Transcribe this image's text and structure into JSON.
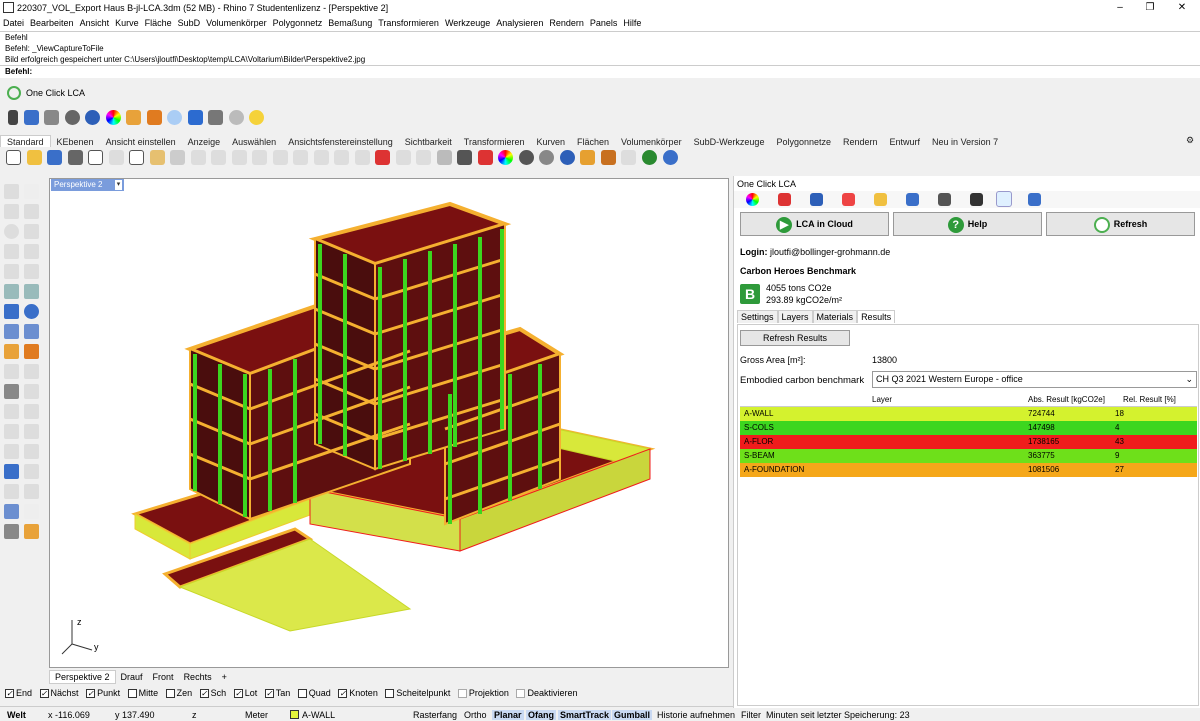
{
  "titlebar": {
    "title": "220307_VOL_Export Haus B-jl-LCA.3dm (52 MB) - Rhino 7 Studentenlizenz - [Perspektive 2]",
    "minimize": "–",
    "maximize": "❐",
    "close": "✕"
  },
  "menu": [
    "Datei",
    "Bearbeiten",
    "Ansicht",
    "Kurve",
    "Fläche",
    "SubD",
    "Volumenkörper",
    "Polygonnetz",
    "Bemaßung",
    "Transformieren",
    "Werkzeuge",
    "Analysieren",
    "Rendern",
    "Panels",
    "Hilfe"
  ],
  "command": {
    "history": [
      "Befehl",
      "Befehl: _ViewCaptureToFile",
      "Bild erfolgreich gespeichert unter C:\\Users\\jloutfi\\Desktop\\temp\\LCA\\Voltarium\\Bilder\\Perspektive2.jpg"
    ],
    "prompt": "Befehl:"
  },
  "toolbar_ocl": {
    "label": "One Click LCA"
  },
  "tabs": [
    "Standard",
    "KEbenen",
    "Ansicht einstellen",
    "Anzeige",
    "Auswählen",
    "Ansichtsfenstereinstellung",
    "Sichtbarkeit",
    "Transformieren",
    "Kurven",
    "Flächen",
    "Volumenkörper",
    "SubD-Werkzeuge",
    "Polygonnetze",
    "Rendern",
    "Entwurf",
    "Neu in Version 7"
  ],
  "viewport": {
    "label": "Perspektive 2",
    "axis_z": "z",
    "axis_y": "y",
    "tabs": [
      "Perspektive 2",
      "Drauf",
      "Front",
      "Rechts"
    ],
    "add_tab": "+"
  },
  "snaps": [
    {
      "label": "End",
      "checked": true
    },
    {
      "label": "Nächst",
      "checked": true
    },
    {
      "label": "Punkt",
      "checked": true
    },
    {
      "label": "Mitte",
      "checked": false
    },
    {
      "label": "Zen",
      "checked": false
    },
    {
      "label": "Sch",
      "checked": true
    },
    {
      "label": "Lot",
      "checked": true
    },
    {
      "label": "Tan",
      "checked": true
    },
    {
      "label": "Quad",
      "checked": false
    },
    {
      "label": "Knoten",
      "checked": true
    },
    {
      "label": "Scheitelpunkt",
      "checked": false
    },
    {
      "label": "Projektion",
      "checked": false,
      "disabled": true
    },
    {
      "label": "Deaktivieren",
      "checked": false,
      "disabled": true
    }
  ],
  "status": {
    "cplane": "Welt",
    "x": "x -116.069",
    "y": "y 137.490",
    "z": "z",
    "units": "Meter",
    "layer": "A-WALL",
    "layer_color": "#e4f53b",
    "rasterfang": "Rasterfang",
    "ortho": "Ortho",
    "planar": "Planar",
    "ofang": "Ofang",
    "smarttrack": "SmartTrack",
    "gumball": "Gumball",
    "history": "Historie aufnehmen",
    "filter": "Filter",
    "saved": "Minuten seit letzter Speicherung: 23"
  },
  "panel": {
    "title": "One Click LCA",
    "buttons": {
      "cloud": "LCA in Cloud",
      "help": "Help",
      "refresh": "Refresh",
      "help_icon": "?"
    },
    "login_label": "Login:",
    "login_value": "jloutfi@bollinger-grohmann.de",
    "benchmark": {
      "title": "Carbon Heroes Benchmark",
      "grade": "B",
      "grade_color": "#2e9a3a",
      "tons": "4055 tons CO2e",
      "per_m2": "293.89 kgCO2e/m²"
    },
    "tabs": [
      "Settings",
      "Layers",
      "Materials",
      "Results"
    ],
    "active_tab": "Results",
    "refresh_results": "Refresh Results",
    "gross_area_label": "Gross Area [m²]:",
    "gross_area_value": "13800",
    "benchmark_label": "Embodied carbon benchmark",
    "benchmark_value": "CH Q3 2021 Western Europe - office",
    "table": {
      "headers": [
        "Layer",
        "Abs. Result [kgCO2e]",
        "Rel. Result [%]"
      ],
      "rows": [
        {
          "layer": "A-WALL",
          "abs": "724744",
          "rel": "18",
          "color": "#d4f22e"
        },
        {
          "layer": "S-COLS",
          "abs": "147498",
          "rel": "4",
          "color": "#3cd61f"
        },
        {
          "layer": "A-FLOR",
          "abs": "1738165",
          "rel": "43",
          "color": "#f01c1c"
        },
        {
          "layer": "S-BEAM",
          "abs": "363775",
          "rel": "9",
          "color": "#6ee01a"
        },
        {
          "layer": "A-FOUNDATION",
          "abs": "1081506",
          "rel": "27",
          "color": "#f5a71a"
        }
      ]
    }
  }
}
